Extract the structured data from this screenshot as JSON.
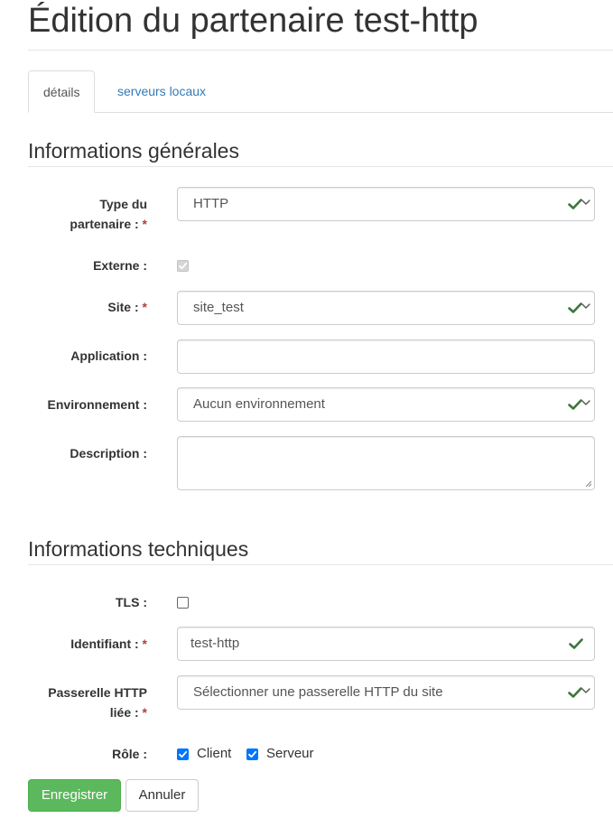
{
  "page": {
    "title": "Édition du partenaire test-http"
  },
  "tabs": [
    {
      "label": "détails",
      "active": true
    },
    {
      "label": "serveurs locaux",
      "active": false
    }
  ],
  "sections": {
    "general": "Informations générales",
    "technical": "Informations techniques"
  },
  "required_marker": "*",
  "form": {
    "type": {
      "label": "Type du",
      "label2": "partenaire :",
      "value": "HTTP"
    },
    "externe": {
      "label": "Externe :",
      "checked": true,
      "disabled": true
    },
    "site": {
      "label": "Site :",
      "value": "site_test"
    },
    "application": {
      "label": "Application :",
      "value": ""
    },
    "environnement": {
      "label": "Environnement :",
      "value": "Aucun environnement"
    },
    "description": {
      "label": "Description :",
      "value": ""
    },
    "tls": {
      "label": "TLS :",
      "checked": false
    },
    "identifiant": {
      "label": "Identifiant :",
      "value": "test-http"
    },
    "passerelle": {
      "label": "Passerelle HTTP",
      "label2": "liée :",
      "value": "Sélectionner une passerelle HTTP du site"
    },
    "role": {
      "label": "Rôle :",
      "client_label": "Client",
      "client_checked": true,
      "serveur_label": "Serveur",
      "serveur_checked": true
    }
  },
  "buttons": {
    "save": "Enregistrer",
    "cancel": "Annuler"
  },
  "colors": {
    "link": "#337ab7",
    "success": "#3c763d",
    "required": "#a94442",
    "primary_button": "#5cb85c",
    "checkbox_on": "#0075ff"
  },
  "icons": {
    "valid": "check-icon",
    "select": "chevron-down-icon"
  }
}
